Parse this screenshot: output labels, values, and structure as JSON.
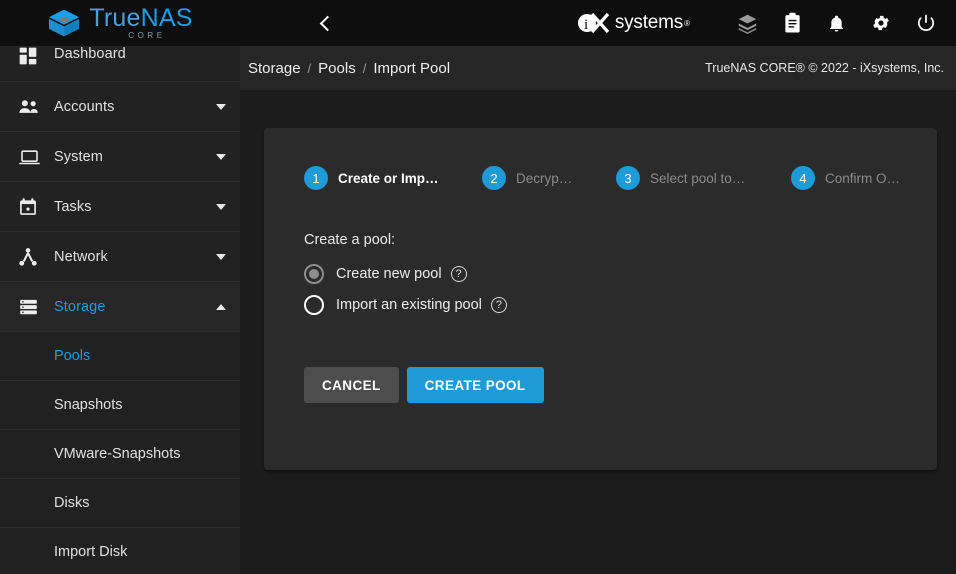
{
  "brand": {
    "name_part1": "True",
    "name_part2": "NAS",
    "edition": "CORE",
    "logo_icon": "truenas-cube-logo",
    "vendor": "systems",
    "vendor_prefix": "iX",
    "vendor_tm": "®"
  },
  "topbar": {
    "menu_icon": "hamburger-menu-icon",
    "back_icon": "chevron-left-icon",
    "actions": [
      {
        "name": "jobs-icon",
        "glyph": "layers-cube-icon"
      },
      {
        "name": "tasks-clipboard-icon",
        "glyph": "clipboard-icon"
      },
      {
        "name": "alerts-bell-icon",
        "glyph": "bell-icon"
      },
      {
        "name": "settings-gear-icon",
        "glyph": "gear-icon"
      },
      {
        "name": "power-icon",
        "glyph": "power-icon"
      }
    ]
  },
  "sidebar": {
    "items": [
      {
        "label": "Dashboard",
        "icon": "dashboard-grid-icon",
        "expandable": false,
        "active": false
      },
      {
        "label": "Accounts",
        "icon": "accounts-people-icon",
        "expandable": true,
        "active": false
      },
      {
        "label": "System",
        "icon": "system-laptop-icon",
        "expandable": true,
        "active": false
      },
      {
        "label": "Tasks",
        "icon": "tasks-calendar-icon",
        "expandable": true,
        "active": false
      },
      {
        "label": "Network",
        "icon": "network-share-icon",
        "expandable": true,
        "active": false
      },
      {
        "label": "Storage",
        "icon": "storage-server-icon",
        "expandable": true,
        "active": true
      }
    ],
    "storage_subitems": [
      {
        "label": "Pools",
        "active": true
      },
      {
        "label": "Snapshots",
        "active": false
      },
      {
        "label": "VMware-Snapshots",
        "active": false
      },
      {
        "label": "Disks",
        "active": false
      },
      {
        "label": "Import Disk",
        "active": false
      }
    ]
  },
  "breadcrumb": {
    "items": [
      "Storage",
      "Pools",
      "Import Pool"
    ],
    "separator": "/",
    "copyright": "TrueNAS CORE® © 2022 - iXsystems, Inc."
  },
  "wizard": {
    "steps": [
      {
        "number": "1",
        "label": "Create or Imp…",
        "active": true
      },
      {
        "number": "2",
        "label": "Decryp…",
        "active": false
      },
      {
        "number": "3",
        "label": "Select pool to…",
        "active": false
      },
      {
        "number": "4",
        "label": "Confirm O…",
        "active": false
      }
    ],
    "section_label": "Create a pool:",
    "options": [
      {
        "label": "Create new pool",
        "selected": true,
        "help_icon": "help-circle-icon"
      },
      {
        "label": "Import an existing pool",
        "selected": false,
        "help_icon": "help-circle-icon"
      }
    ],
    "buttons": {
      "cancel": "CANCEL",
      "submit": "CREATE POOL"
    }
  },
  "colors": {
    "accent": "#1e9bd7",
    "page_bg": "#1c1c1c",
    "card_bg": "#2b2b2b",
    "sidebar_bg": "#222222",
    "topbar_bg": "#0e0e0e"
  }
}
